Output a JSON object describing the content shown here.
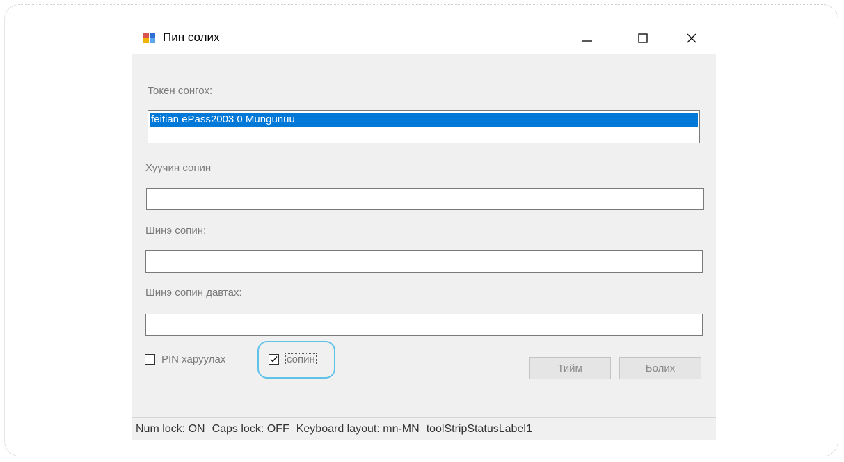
{
  "window": {
    "title": "Пин солих",
    "minimize_symbol": "—",
    "maximize_symbol": "☐",
    "close_symbol": "✕"
  },
  "token": {
    "label": "Токен сонгох:",
    "items": [
      "feitian ePass2003 0 Mungunuu"
    ],
    "selected_index": 0
  },
  "old_pin": {
    "label": "Хуучин сопин",
    "value": ""
  },
  "new_pin": {
    "label": "Шинэ сопин:",
    "value": ""
  },
  "confirm_pin": {
    "label": "Шинэ сопин давтах:",
    "value": ""
  },
  "checkboxes": {
    "show_pin": {
      "label": "PIN харуулах",
      "checked": false
    },
    "sopin": {
      "label": "сопин",
      "checked": true
    }
  },
  "buttons": {
    "ok": "Тийм",
    "cancel": "Болих"
  },
  "statusbar": {
    "num_lock": "Num lock: ON",
    "caps_lock": "Caps lock: OFF",
    "keyboard_layout": "Keyboard layout: mn-MN",
    "label1": "toolStripStatusLabel1"
  },
  "colors": {
    "selection": "#0078d7",
    "highlight_ring": "#5fc3e8",
    "window_bg": "#f0f0f0"
  }
}
